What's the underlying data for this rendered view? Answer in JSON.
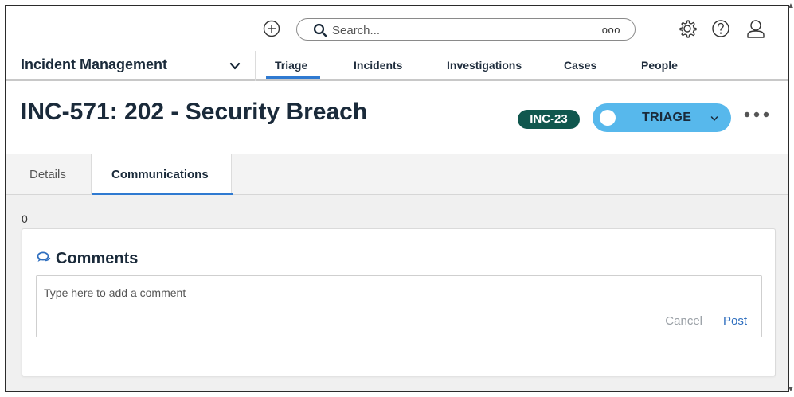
{
  "topbar": {
    "search_placeholder": "Search...",
    "search_more": "ooo",
    "icons": [
      "add-icon",
      "search-icon",
      "settings-icon",
      "help-icon",
      "user-icon"
    ]
  },
  "appnav": {
    "app_name": "Incident Management",
    "tabs": [
      "Triage",
      "Incidents",
      "Investigations",
      "Cases",
      "People"
    ],
    "active_tab": "Triage"
  },
  "header": {
    "title": "INC-571: 202 - Security Breach",
    "badge": "INC-23",
    "status_label": "TRIAGE",
    "badge_color": "#10574e",
    "status_color": "#57b8ec"
  },
  "tabs": {
    "items": [
      "Details",
      "Communications"
    ],
    "active": "Communications"
  },
  "content": {
    "count": "0",
    "comments": {
      "title": "Comments",
      "placeholder": "Type here to add a comment",
      "cancel_label": "Cancel",
      "post_label": "Post"
    }
  },
  "colors": {
    "accent": "#2f7ad1"
  }
}
